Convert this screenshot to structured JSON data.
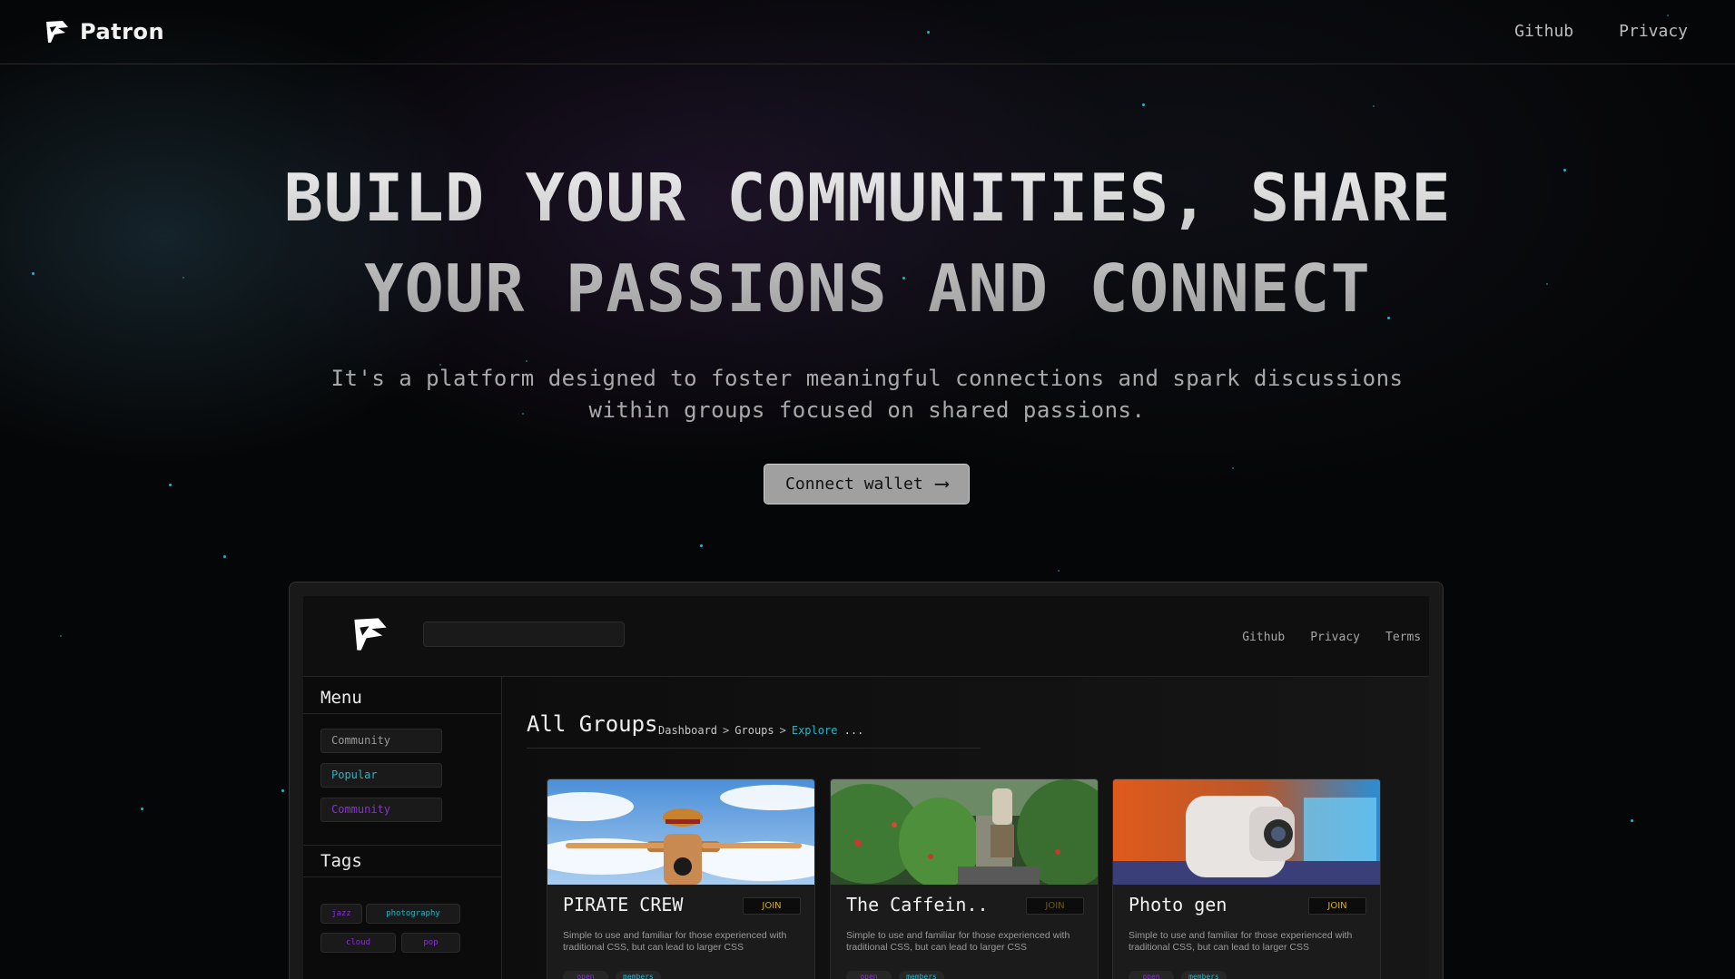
{
  "brand": {
    "name": "Patron",
    "logo_icon": "patron-flag-logo"
  },
  "nav": {
    "links": [
      "Github",
      "Privacy"
    ]
  },
  "hero": {
    "title_line1": "BUILD YOUR COMMUNITIES, SHARE",
    "title_line2": "YOUR PASSIONS AND CONNECT",
    "subtitle_line1": "It's a platform designed to foster meaningful connections and spark discussions",
    "subtitle_line2": "within groups focused on shared passions.",
    "cta_label": "Connect wallet",
    "cta_icon": "arrow-right-icon"
  },
  "preview": {
    "search_placeholder": "",
    "links": [
      "Github",
      "Privacy",
      "Terms"
    ],
    "menu_title": "Menu",
    "menu_items": [
      {
        "label": "Community",
        "color": "#9a9a9a"
      },
      {
        "label": "Popular",
        "color": "#28b4c6"
      },
      {
        "label": "Community",
        "color": "#8a2fd6"
      }
    ],
    "tags_title": "Tags",
    "tags": [
      {
        "label": "jazz",
        "color": "#8a2fd6"
      },
      {
        "label": "photography",
        "color": "#28b4c6"
      },
      {
        "label": "cloud",
        "color": "#8a2fd6"
      },
      {
        "label": "pop",
        "color": "#8a2fd6"
      }
    ],
    "heading": "All Groups",
    "breadcrumb": {
      "items": [
        "Dashboard",
        "Groups"
      ],
      "separator": ">",
      "active": "Explore",
      "trailing": "..."
    },
    "cards": [
      {
        "title": "PIRATE CREW",
        "join": "JOIN",
        "desc": "Simple to use and familiar for those experienced with traditional CSS, but can lead to larger CSS",
        "tags": [
          "open",
          "members"
        ]
      },
      {
        "title": "The Caffein..",
        "join": "JOIN",
        "desc": "Simple to use and familiar for those experienced with traditional CSS, but can lead to larger CSS",
        "tags": [
          "open",
          "members"
        ]
      },
      {
        "title": "Photo gen",
        "join": "JOIN",
        "desc": "Simple to use and familiar for those experienced with traditional CSS, but can lead to larger CSS",
        "tags": [
          "open",
          "members"
        ]
      }
    ]
  },
  "colors": {
    "accent_cyan": "#28b4c6",
    "accent_purple": "#8a2fd6",
    "join_gold": "#d6b11c",
    "background": "#050607"
  }
}
